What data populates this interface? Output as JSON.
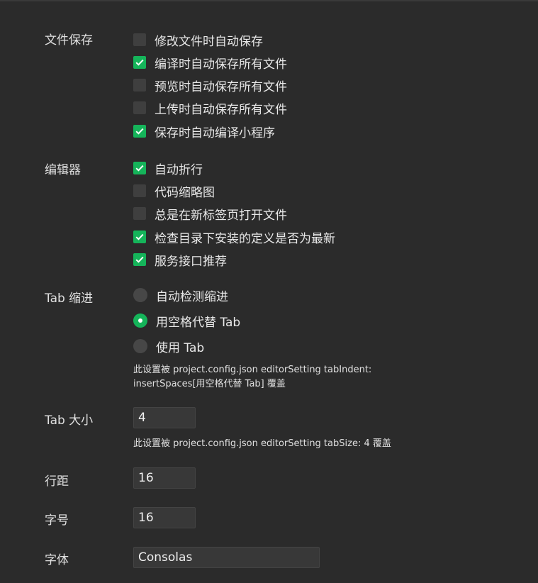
{
  "file_save": {
    "label": "文件保存",
    "options": [
      {
        "label": "修改文件时自动保存",
        "checked": false
      },
      {
        "label": "编译时自动保存所有文件",
        "checked": true
      },
      {
        "label": "预览时自动保存所有文件",
        "checked": false
      },
      {
        "label": "上传时自动保存所有文件",
        "checked": false
      },
      {
        "label": "保存时自动编译小程序",
        "checked": true
      }
    ]
  },
  "editor": {
    "label": "编辑器",
    "options": [
      {
        "label": "自动折行",
        "checked": true
      },
      {
        "label": "代码缩略图",
        "checked": false
      },
      {
        "label": "总是在新标签页打开文件",
        "checked": false
      },
      {
        "label": "检查目录下安装的定义是否为最新",
        "checked": true
      },
      {
        "label": "服务接口推荐",
        "checked": true
      }
    ]
  },
  "tab_indent": {
    "label": "Tab 缩进",
    "options": [
      {
        "label": "自动检测缩进",
        "selected": false
      },
      {
        "label": "用空格代替 Tab",
        "selected": true
      },
      {
        "label": "使用 Tab",
        "selected": false
      }
    ],
    "note_line1": "此设置被 project.config.json editorSetting tabIndent:",
    "note_line2": "insertSpaces[用空格代替 Tab] 覆盖"
  },
  "tab_size": {
    "label": "Tab 大小",
    "value": "4",
    "note": "此设置被 project.config.json editorSetting tabSize: 4 覆盖"
  },
  "line_height": {
    "label": "行距",
    "value": "16"
  },
  "font_size": {
    "label": "字号",
    "value": "16"
  },
  "font_family": {
    "label": "字体",
    "value": "Consolas"
  },
  "colors": {
    "background": "#2b2b2b",
    "accent": "#15b45a",
    "unchecked": "#3f3f3f"
  }
}
